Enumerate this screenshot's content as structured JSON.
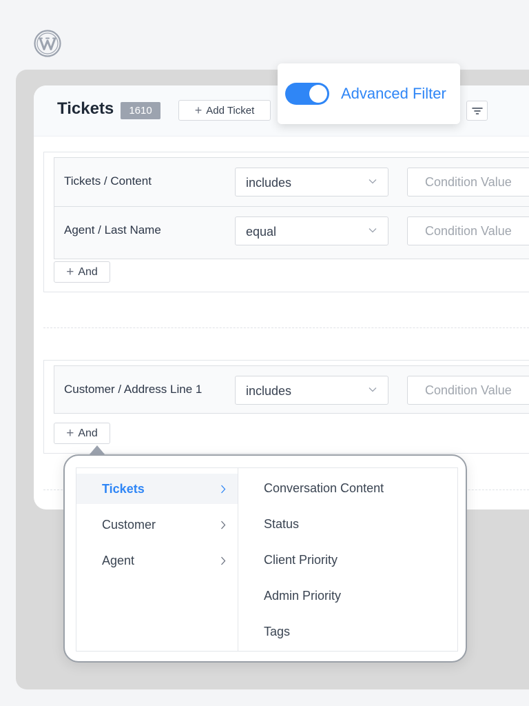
{
  "header": {
    "title": "Tickets",
    "count": "1610",
    "add_ticket_label": "Add Ticket"
  },
  "advanced_filter": {
    "label": "Advanced Filter",
    "enabled": true
  },
  "filter_groups": [
    {
      "rows": [
        {
          "field": "Tickets / Content",
          "operator": "includes",
          "value_placeholder": "Condition Value"
        },
        {
          "field": "Agent / Last Name",
          "operator": "equal",
          "value_placeholder": "Condition Value"
        }
      ],
      "and_label": "And"
    },
    {
      "rows": [
        {
          "field": "Customer / Address Line 1",
          "operator": "includes",
          "value_placeholder": "Condition Value"
        }
      ],
      "and_label": "And"
    }
  ],
  "field_picker": {
    "categories": [
      {
        "label": "Tickets",
        "active": true
      },
      {
        "label": "Customer",
        "active": false
      },
      {
        "label": "Agent",
        "active": false
      }
    ],
    "fields": [
      "Conversation Content",
      "Status",
      "Client Priority",
      "Admin Priority",
      "Tags"
    ]
  },
  "colors": {
    "accent": "#2f86f6",
    "badge": "#9ca3af"
  },
  "icons": {
    "logo": "wordpress-logo",
    "filter": "filter-lines-icon",
    "chevron_down": "chevron-down-icon",
    "chevron_right": "chevron-right-icon",
    "plus": "plus-icon"
  }
}
